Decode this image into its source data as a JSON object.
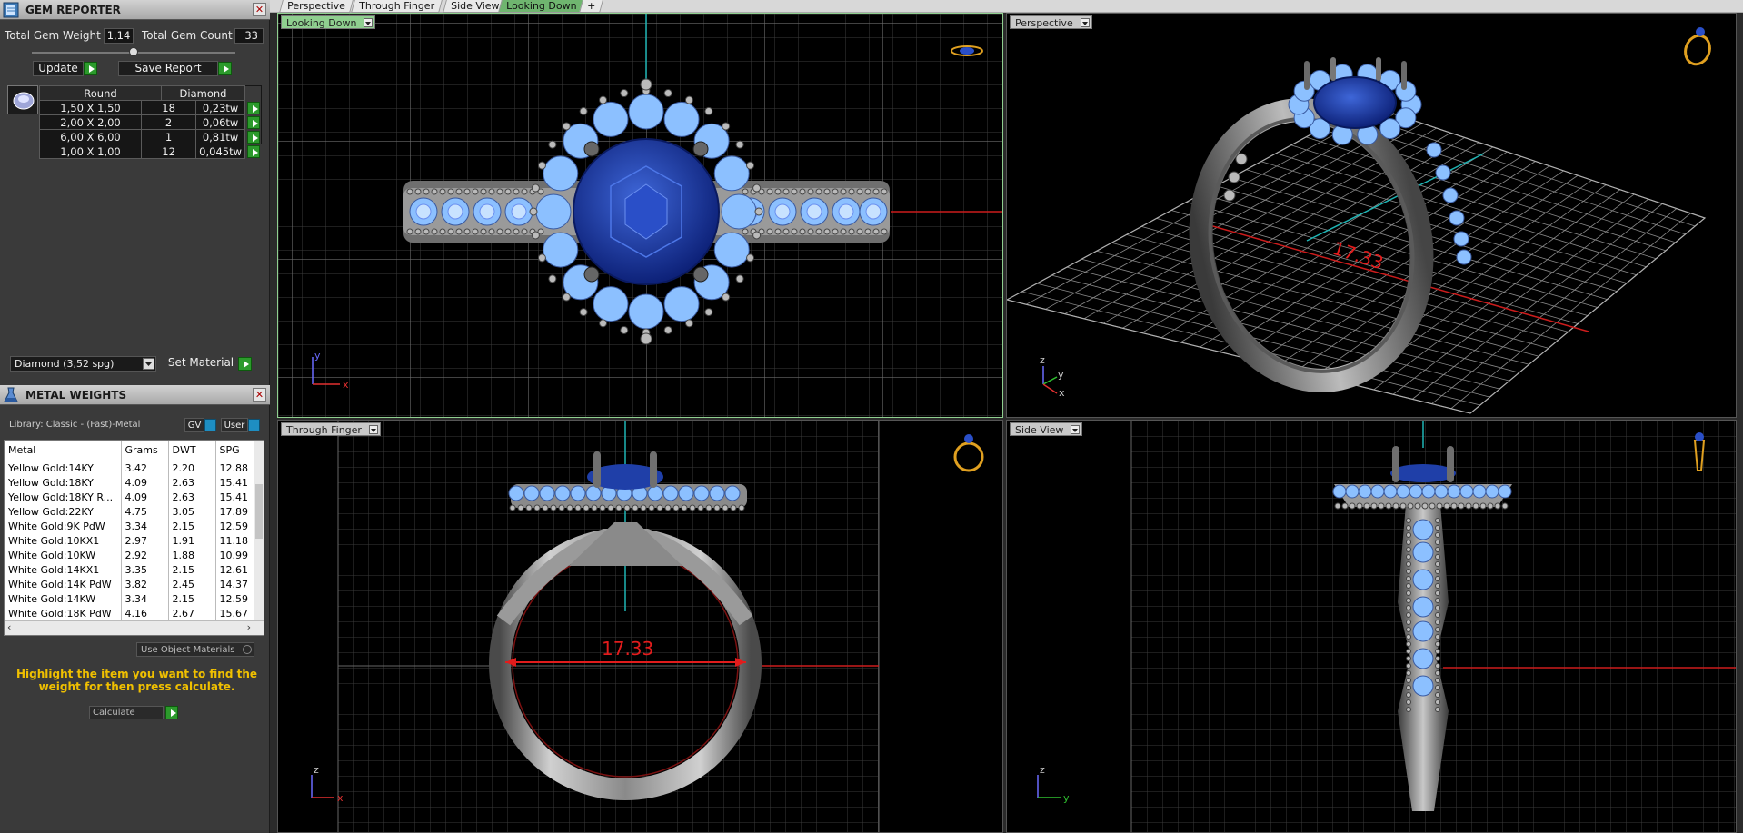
{
  "gem_reporter": {
    "title": "GEM REPORTER",
    "total_gem_weight_label": "Total Gem Weight",
    "total_gem_weight_value": "1,14",
    "total_gem_count_label": "Total Gem Count",
    "total_gem_count_value": "33",
    "update_label": "Update",
    "save_report_label": "Save Report",
    "table_headers": {
      "shape": "Round",
      "type": "Diamond"
    },
    "rows": [
      {
        "size": "1,50 X 1,50",
        "count": "18",
        "weight": "0,23tw"
      },
      {
        "size": "2,00 X 2,00",
        "count": "2",
        "weight": "0,06tw"
      },
      {
        "size": "6,00 X 6,00",
        "count": "1",
        "weight": "0,81tw"
      },
      {
        "size": "1,00 X 1,00",
        "count": "12",
        "weight": "0,045tw"
      }
    ],
    "material_select": "Diamond   (3,52 spg)",
    "set_material_label": "Set Material"
  },
  "metal_weights": {
    "title": "METAL WEIGHTS",
    "library_label": "Library: Classic - (Fast)-Metal",
    "gv_label": "GV",
    "user_label": "User",
    "columns": [
      "Metal",
      "Grams",
      "DWT",
      "SPG"
    ],
    "rows": [
      [
        "Yellow Gold:14KY",
        "3.42",
        "2.20",
        "12.88"
      ],
      [
        "Yellow Gold:18KY",
        "4.09",
        "2.63",
        "15.41"
      ],
      [
        "Yellow Gold:18KY R...",
        "4.09",
        "2.63",
        "15.41"
      ],
      [
        "Yellow Gold:22KY",
        "4.75",
        "3.05",
        "17.89"
      ],
      [
        "White Gold:9K PdW",
        "3.34",
        "2.15",
        "12.59"
      ],
      [
        "White Gold:10KX1",
        "2.97",
        "1.91",
        "11.18"
      ],
      [
        "White Gold:10KW",
        "2.92",
        "1.88",
        "10.99"
      ],
      [
        "White Gold:14KX1",
        "3.35",
        "2.15",
        "12.61"
      ],
      [
        "White Gold:14K PdW",
        "3.82",
        "2.45",
        "14.37"
      ],
      [
        "White Gold:14KW",
        "3.34",
        "2.15",
        "12.59"
      ],
      [
        "White Gold:18K PdW",
        "4.16",
        "2.67",
        "15.67"
      ]
    ],
    "use_object_materials_label": "Use Object Materials",
    "hint": "Highlight the item you want to find the weight for then press calculate.",
    "calculate_label": "Calculate"
  },
  "top_tabs": [
    "Perspective",
    "Through Finger",
    "Side View",
    "Looking Down",
    "+"
  ],
  "viewports": {
    "looking_down": {
      "label": "Looking Down",
      "axis_a": "y",
      "axis_b": "x"
    },
    "perspective": {
      "label": "Perspective",
      "measurement": "17.33",
      "axis_a": "z",
      "axis_b": "y",
      "axis_c": "x"
    },
    "through_finger": {
      "label": "Through Finger",
      "measurement": "17.33",
      "axis_a": "z",
      "axis_b": "x"
    },
    "side_view": {
      "label": "Side View",
      "axis_a": "z",
      "axis_b": "y"
    }
  },
  "colors": {
    "accent_green": "#2c9a2c",
    "gem_blue": "#1f3fa8",
    "accent_gem_light": "#8cc0ff",
    "measure_red": "#e21c1c",
    "axis_cyan": "#1fb5b5",
    "hint_yellow": "#f0c000"
  }
}
